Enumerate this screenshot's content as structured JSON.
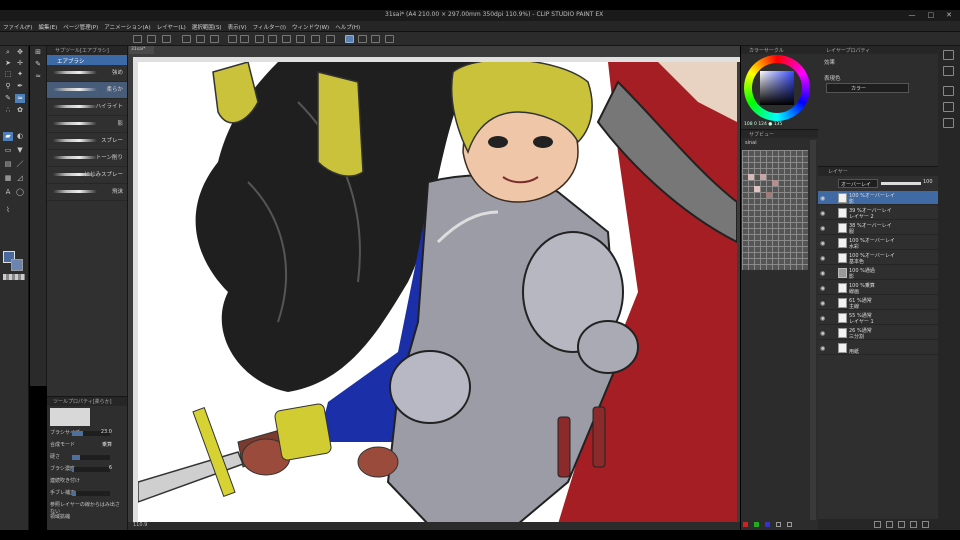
{
  "window": {
    "title": "31sai* (A4 210.00 × 297.00mm 350dpi 110.9%) - CLIP STUDIO PAINT EX",
    "minimize": "—",
    "maximize": "□",
    "close": "✕"
  },
  "menu": [
    "ファイル(F)",
    "編集(E)",
    "ページ管理(P)",
    "アニメーション(A)",
    "レイヤー(L)",
    "選択範囲(S)",
    "表示(V)",
    "フィルター(I)",
    "ウィンドウ(W)",
    "ヘルプ(H)"
  ],
  "canvas_tab": "31sai*",
  "subtool": {
    "panel_title": "サブツール[エアブラシ]",
    "group": "エアブラシ",
    "brushes": [
      {
        "label": "強め",
        "selected": false
      },
      {
        "label": "柔らか",
        "selected": true
      },
      {
        "label": "ハイライト",
        "selected": false
      },
      {
        "label": "影",
        "selected": false
      },
      {
        "label": "スプレー",
        "selected": false
      },
      {
        "label": "トーン削り",
        "selected": false
      },
      {
        "label": "にじみスプレー",
        "selected": false
      },
      {
        "label": "飛沫",
        "selected": false
      }
    ]
  },
  "tool_property": {
    "title": "ツールプロパティ[柔らか]",
    "rows": [
      {
        "label": "ブラシサイズ",
        "value": "23.0",
        "fraction": 0.3
      },
      {
        "label": "合成モード",
        "value": "乗算",
        "fraction": 0
      },
      {
        "label": "硬さ",
        "value": "",
        "fraction": 0.2
      },
      {
        "label": "ブラシ濃度",
        "value": "6",
        "fraction": 0.06
      },
      {
        "label": "連続吹き付け",
        "value": "",
        "fraction": 0
      },
      {
        "label": "手ブレ補正",
        "value": "",
        "fraction": 0.1
      },
      {
        "label": "参照レイヤーの線からはみ出さない",
        "value": "",
        "fraction": 0
      },
      {
        "label": "領域拡縮",
        "value": "",
        "fraction": 0
      }
    ]
  },
  "color": {
    "panel_title": "カラーサークル",
    "readout": "108  0  124  ●  135",
    "main": "#4a6a9e",
    "sub": "#6a86b0"
  },
  "subview": {
    "panel_title": "サブビュー",
    "label": "sinai"
  },
  "layer_property": {
    "panel_title": "レイヤープロパティ",
    "effect_label": "効果",
    "expression_color_label": "表現色",
    "expression_color_value": "カラー"
  },
  "layers": {
    "panel_title": "レイヤー",
    "blend_mode": "オーバーレイ",
    "opacity": "100",
    "items": [
      {
        "line1": "100 %オーバーレイ",
        "line2": "影",
        "selected": true,
        "folder": false
      },
      {
        "line1": "39 %オーバーレイ",
        "line2": "レイヤー 2",
        "selected": false,
        "folder": false
      },
      {
        "line1": "38 %オーバーレイ",
        "line2": "服",
        "selected": false,
        "folder": false
      },
      {
        "line1": "100 %オーバーレイ",
        "line2": "水彩",
        "selected": false,
        "folder": false
      },
      {
        "line1": "100 %オーバーレイ",
        "line2": "基本色",
        "selected": false,
        "folder": false
      },
      {
        "line1": "100 %通過",
        "line2": "影",
        "selected": false,
        "folder": true
      },
      {
        "line1": "100 %乗算",
        "line2": "線画",
        "selected": false,
        "folder": false
      },
      {
        "line1": "61 %通常",
        "line2": "主線",
        "selected": false,
        "folder": false
      },
      {
        "line1": "55 %通常",
        "line2": "レイヤー 1",
        "selected": false,
        "folder": false
      },
      {
        "line1": "26 %通常",
        "line2": "三分割",
        "selected": false,
        "folder": false
      },
      {
        "line1": "",
        "line2": "用紙",
        "selected": false,
        "folder": false
      }
    ]
  },
  "status": {
    "zoom": "110.9"
  }
}
